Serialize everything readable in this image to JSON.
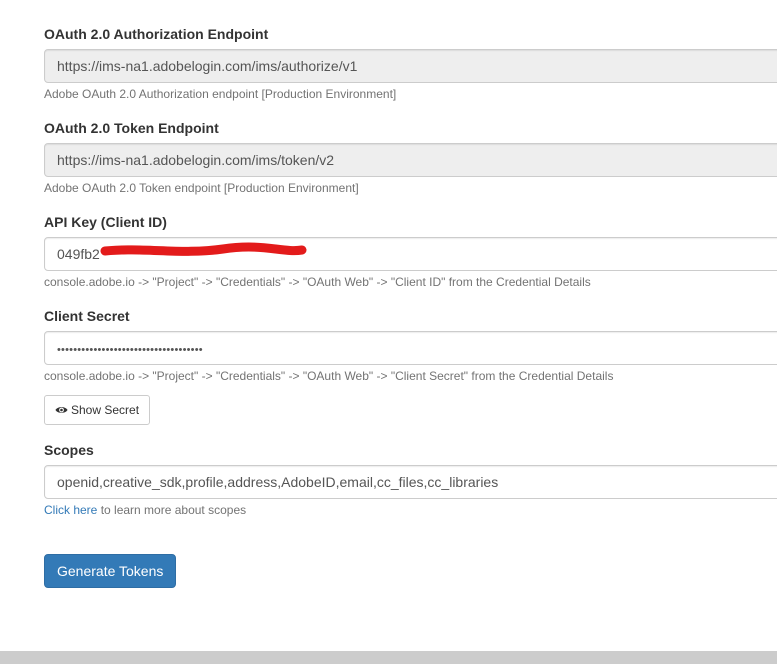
{
  "auth_endpoint": {
    "label": "OAuth 2.0 Authorization Endpoint",
    "value": "https://ims-na1.adobelogin.com/ims/authorize/v1",
    "help": "Adobe OAuth 2.0 Authorization endpoint [Production Environment]"
  },
  "token_endpoint": {
    "label": "OAuth 2.0 Token Endpoint",
    "value": "https://ims-na1.adobelogin.com/ims/token/v2",
    "help": "Adobe OAuth 2.0 Token endpoint [Production Environment]"
  },
  "api_key": {
    "label": "API Key (Client ID)",
    "value": "049fb2",
    "help": "console.adobe.io -> \"Project\" -> \"Credentials\" -> \"OAuth Web\" -> \"Client ID\" from the Credential Details",
    "redaction_color": "#e31b1b"
  },
  "client_secret": {
    "label": "Client Secret",
    "value": "••••••••••••••••••••••••••••••••••••",
    "help": "console.adobe.io -> \"Project\" -> \"Credentials\" -> \"OAuth Web\" -> \"Client Secret\" from the Credential Details",
    "show_button_label": "Show Secret",
    "show_button_icon": "eye-icon"
  },
  "scopes": {
    "label": "Scopes",
    "value": "openid,creative_sdk,profile,address,AdobeID,email,cc_files,cc_libraries",
    "help_link": "Click here",
    "help_rest": " to learn more about scopes"
  },
  "generate_button_label": "Generate Tokens",
  "colors": {
    "primary": "#337ab7",
    "link": "#337ab7",
    "readonly_bg": "#eeeeee",
    "border": "#cccccc"
  }
}
